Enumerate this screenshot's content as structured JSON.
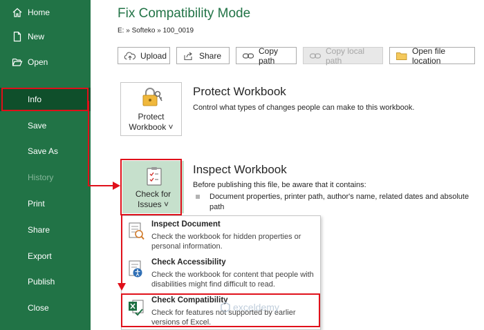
{
  "sidebar": {
    "items": [
      {
        "label": "Home"
      },
      {
        "label": "New"
      },
      {
        "label": "Open"
      },
      {
        "label": "Info"
      },
      {
        "label": "Save"
      },
      {
        "label": "Save As"
      },
      {
        "label": "History"
      },
      {
        "label": "Print"
      },
      {
        "label": "Share"
      },
      {
        "label": "Export"
      },
      {
        "label": "Publish"
      },
      {
        "label": "Close"
      }
    ]
  },
  "header": {
    "title": "Fix Compatibility Mode",
    "breadcrumb": "E: » Softeko » 100_0019"
  },
  "toolbar": {
    "upload": "Upload",
    "share": "Share",
    "copy_path": "Copy path",
    "copy_local_path": "Copy local path",
    "open_location": "Open file location"
  },
  "protect": {
    "button_line1": "Protect",
    "button_line2": "Workbook ˅",
    "heading": "Protect Workbook",
    "description": "Control what types of changes people can make to this workbook."
  },
  "inspect": {
    "button_line1": "Check for",
    "button_line2": "Issues ˅",
    "heading": "Inspect Workbook",
    "description": "Before publishing this file, be aware that it contains:",
    "bullet": "Document properties, printer path, author's name, related dates and absolute path"
  },
  "dropdown": {
    "items": [
      {
        "title": "Inspect Document",
        "desc": "Check the workbook for hidden properties or personal information."
      },
      {
        "title": "Check Accessibility",
        "desc": "Check the workbook for content that people with disabilities might find difficult to read."
      },
      {
        "title": "Check Compatibility",
        "desc": "Check for features not supported by earlier versions of Excel."
      }
    ]
  },
  "watermark": {
    "text": "exceldemy"
  },
  "colors": {
    "sidebar": "#217346",
    "active": "#0f4f2b",
    "highlight": "#e0101a"
  }
}
